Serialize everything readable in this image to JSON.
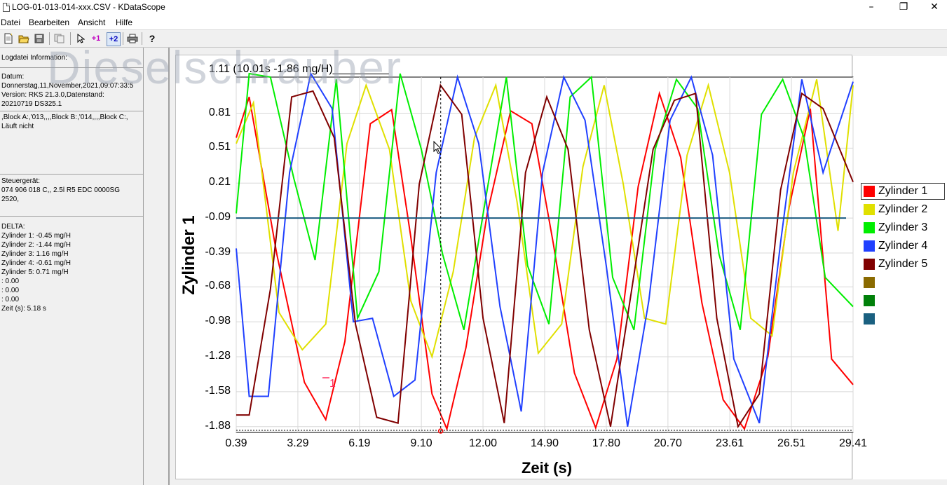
{
  "window": {
    "title": "LOG-01-013-014-xxx.CSV - KDataScope",
    "minimize": "–",
    "maximize": "❐",
    "close": "✕"
  },
  "menu": [
    "Datei",
    "Bearbeiten",
    "Ansicht",
    "Hilfe"
  ],
  "toolbar": {
    "icons": [
      "new-file-icon",
      "open-folder-icon",
      "save-icon",
      "copy-icon",
      "pointer-icon",
      "add-marker-1-icon",
      "add-marker-2-icon",
      "print-icon",
      "help-icon"
    ],
    "marker1": "+1",
    "marker2": "+2",
    "help": "?"
  },
  "info": {
    "logdatei": "Logdatei Information:",
    "datum_label": "Datum:",
    "datum_value": "Donnerstag,11,November,2021,09:07:33:5",
    "version": "Version: RKS 21.3.0,Datenstand:",
    "version2": "20210719 DS325.1",
    "blocks": ",Block A:,'013,,,,Block B:,'014,,,,Block C:,",
    "status": "Läuft nicht",
    "steuergeraet_label": "Steuergerät:",
    "steuergeraet_value": "074 906 018 C,, 2.5l R5 EDC 0000SG",
    "steuergeraet_num": "2520,",
    "delta_label": "DELTA:",
    "delta": [
      "Zylinder 1: -0.45  mg/H",
      "Zylinder 2: -1.44  mg/H",
      "Zylinder 3: 1.16  mg/H",
      "Zylinder 4: -0.61  mg/H",
      "Zylinder 5: 0.71  mg/H",
      ": 0.00",
      ": 0.00",
      ": 0.00",
      "Zeit (s): 5.18 s"
    ]
  },
  "watermark": "Dieselschrauber",
  "readout": "1.11 (10.01s  -1.86 mg/H)_________",
  "marker_label": "1",
  "chart_data": {
    "type": "line",
    "ylabel": "Zylinder 1",
    "xlabel": "Zeit (s)",
    "yticks": [
      "0.81",
      "0.51",
      "0.21",
      "-0.09",
      "-0.39",
      "-0.68",
      "-0.98",
      "-1.28",
      "-1.58",
      "-1.88"
    ],
    "xticks": [
      "0.39",
      "3.29",
      "6.19",
      "9.10",
      "12.00",
      "14.90",
      "17.80",
      "20.70",
      "23.61",
      "26.51",
      "29.41"
    ],
    "ylim": [
      -1.93,
      1.12
    ],
    "xlim": [
      0.39,
      29.41
    ],
    "baseline": -0.09,
    "cursor_x": 10.01,
    "series": [
      {
        "name": "Zylinder 1",
        "color": "#ff0000",
        "x": [
          0.39,
          1.0,
          2.3,
          3.6,
          4.6,
          5.5,
          6.7,
          7.7,
          8.6,
          9.6,
          10.3,
          11.2,
          12.2,
          13.3,
          14.3,
          15.3,
          16.3,
          17.3,
          18.3,
          19.3,
          20.3,
          21.3,
          22.3,
          23.3,
          24.3,
          25.4,
          26.4,
          27.4,
          28.4,
          29.41
        ],
        "y": [
          0.6,
          0.95,
          -0.4,
          -1.5,
          -1.82,
          -1.15,
          0.72,
          0.84,
          -0.25,
          -1.6,
          -1.9,
          -1.2,
          -0.05,
          0.83,
          0.72,
          -0.3,
          -1.42,
          -1.89,
          -1.3,
          0.18,
          0.98,
          0.43,
          -0.82,
          -1.65,
          -1.9,
          -1.28,
          0.0,
          0.85,
          -1.3,
          -1.52
        ]
      },
      {
        "name": "Zylinder 2",
        "color": "#e0e000",
        "x": [
          0.39,
          1.2,
          2.4,
          3.5,
          4.6,
          5.6,
          6.5,
          7.6,
          8.6,
          9.6,
          10.6,
          11.6,
          12.6,
          13.6,
          14.6,
          15.7,
          16.7,
          17.7,
          18.6,
          19.6,
          20.6,
          21.6,
          22.6,
          23.6,
          24.6,
          25.6,
          26.6,
          27.7,
          28.7,
          29.41
        ],
        "y": [
          0.55,
          0.9,
          -0.9,
          -1.22,
          -1.0,
          0.55,
          1.05,
          0.5,
          -0.8,
          -1.28,
          -0.55,
          0.6,
          1.05,
          0.05,
          -1.25,
          -1.0,
          0.35,
          1.05,
          0.2,
          -0.95,
          -1.0,
          0.45,
          1.05,
          0.3,
          -0.95,
          -1.1,
          0.3,
          1.1,
          -0.2,
          1.05
        ]
      },
      {
        "name": "Zylinder 3",
        "color": "#00ee00",
        "x": [
          0.39,
          1.0,
          2.0,
          3.1,
          4.1,
          5.1,
          6.1,
          7.1,
          8.1,
          9.1,
          10.1,
          11.1,
          12.1,
          13.1,
          14.1,
          15.1,
          16.1,
          17.1,
          18.1,
          19.1,
          20.1,
          21.1,
          22.1,
          23.1,
          24.1,
          25.1,
          26.1,
          27.1,
          28.1,
          29.41
        ],
        "y": [
          -0.05,
          1.15,
          1.12,
          0.25,
          -0.45,
          1.1,
          -0.95,
          -0.55,
          1.15,
          0.5,
          -0.4,
          -1.05,
          0.05,
          1.12,
          -0.5,
          -1.0,
          0.95,
          1.12,
          -0.6,
          -1.05,
          0.5,
          1.1,
          0.85,
          -0.4,
          -1.05,
          0.8,
          1.1,
          0.6,
          -0.6,
          -0.85
        ]
      },
      {
        "name": "Zylinder 4",
        "color": "#2040ff",
        "x": [
          0.39,
          1.0,
          1.9,
          2.9,
          3.9,
          4.9,
          5.9,
          6.8,
          7.8,
          8.8,
          9.8,
          10.8,
          11.8,
          12.8,
          13.8,
          14.8,
          15.8,
          16.8,
          17.8,
          18.8,
          19.8,
          20.8,
          21.8,
          22.8,
          23.8,
          25.0,
          26.0,
          27.0,
          28.0,
          29.41
        ],
        "y": [
          -0.35,
          -1.62,
          -1.62,
          0.3,
          1.15,
          0.85,
          -0.98,
          -0.95,
          -1.62,
          -1.48,
          0.3,
          1.12,
          0.55,
          -0.85,
          -1.75,
          0.3,
          1.12,
          0.75,
          -0.5,
          -1.88,
          -0.8,
          0.75,
          1.12,
          0.45,
          -1.3,
          -1.85,
          -0.3,
          1.1,
          0.3,
          1.08
        ]
      },
      {
        "name": "Zylinder 5",
        "color": "#800000",
        "x": [
          0.39,
          1.0,
          2.0,
          3.0,
          4.0,
          5.0,
          6.0,
          7.0,
          8.0,
          9.0,
          10.0,
          11.0,
          12.0,
          13.0,
          14.0,
          15.0,
          16.0,
          17.0,
          18.0,
          19.0,
          20.0,
          21.0,
          22.0,
          23.0,
          24.0,
          25.0,
          26.0,
          27.0,
          28.0,
          29.41
        ],
        "y": [
          -1.78,
          -1.78,
          -0.7,
          0.95,
          1.0,
          0.6,
          -1.0,
          -1.8,
          -1.85,
          0.2,
          1.05,
          0.8,
          -0.95,
          -1.85,
          0.3,
          0.95,
          0.5,
          -1.05,
          -1.88,
          -0.7,
          0.5,
          0.92,
          0.98,
          -0.95,
          -1.88,
          -1.6,
          0.15,
          0.98,
          0.85,
          0.22
        ]
      }
    ],
    "legend": [
      {
        "name": "Zylinder 1",
        "color": "#ff0000"
      },
      {
        "name": "Zylinder 2",
        "color": "#e0e000"
      },
      {
        "name": "Zylinder 3",
        "color": "#00ee00"
      },
      {
        "name": "Zylinder 4",
        "color": "#2040ff"
      },
      {
        "name": "Zylinder 5",
        "color": "#800000"
      },
      {
        "name": "",
        "color": "#8a6a00"
      },
      {
        "name": "",
        "color": "#00800a"
      },
      {
        "name": "",
        "color": "#1a6080"
      }
    ]
  }
}
